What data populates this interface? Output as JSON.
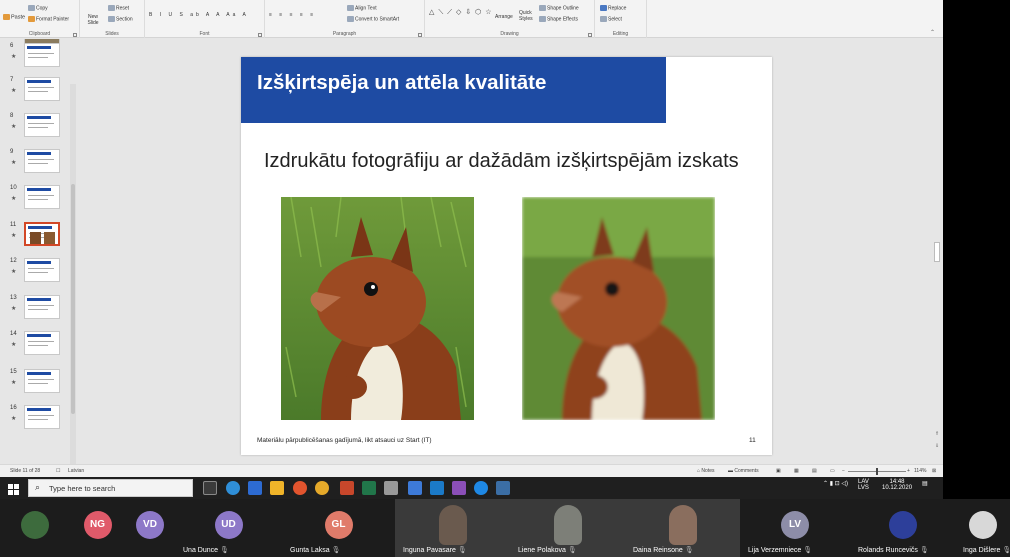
{
  "ribbon": {
    "clipboard": {
      "paste": "Paste",
      "copy": "Copy",
      "format_painter": "Format Painter",
      "label": "Clipboard"
    },
    "slides": {
      "new_slide": "New Slide",
      "reset": "Reset",
      "section": "Section",
      "label": "Slides"
    },
    "font": {
      "label": "Font"
    },
    "paragraph": {
      "align_text": "Align Text",
      "convert_smartart": "Convert to SmartArt",
      "label": "Paragraph"
    },
    "drawing": {
      "arrange": "Arrange",
      "quick_styles": "Quick Styles",
      "shape_outline": "Shape Outline",
      "shape_effects": "Shape Effects",
      "label": "Drawing"
    },
    "editing": {
      "replace": "Replace",
      "select": "Select",
      "label": "Editing"
    }
  },
  "thumbnails": [
    {
      "num": "6",
      "active": false
    },
    {
      "num": "7",
      "active": false
    },
    {
      "num": "8",
      "active": false
    },
    {
      "num": "9",
      "active": false
    },
    {
      "num": "10",
      "active": false
    },
    {
      "num": "11",
      "active": true
    },
    {
      "num": "12",
      "active": false
    },
    {
      "num": "13",
      "active": false
    },
    {
      "num": "14",
      "active": false
    },
    {
      "num": "15",
      "active": false
    },
    {
      "num": "16",
      "active": false
    }
  ],
  "slide": {
    "title": "Izšķirtspēja un attēla kvalitāte",
    "body": "Izdrukātu fotogrāfiju ar dažādām izšķirtspējām izskats",
    "footer": "Materiālu pārpublicēšanas gadījumā, likt atsauci uz Start (IT)",
    "number": "11",
    "banner_color": "#1e4ba3"
  },
  "statusbar": {
    "slide_info": "Slide 11 of 28",
    "language": "Latvian",
    "notes": "Notes",
    "comments": "Comments",
    "zoom": "114%"
  },
  "taskbar": {
    "search_placeholder": "Type here to search",
    "lang": "LAV",
    "lang2": "LVS",
    "time": "14:48",
    "date": "10.12.2020"
  },
  "participants": [
    {
      "initials": "",
      "name": "",
      "color": "#3d6b3d",
      "type": "avatar-photo"
    },
    {
      "initials": "NG",
      "name": "",
      "color": "#e05a6a",
      "type": "initials"
    },
    {
      "initials": "VD",
      "name": "",
      "color": "#8d78c8",
      "type": "initials"
    },
    {
      "initials": "UD",
      "name": "Una Dunce",
      "color": "#8d78c8",
      "type": "initials"
    },
    {
      "initials": "GL",
      "name": "Gunta Laksa",
      "color": "#e07b6a",
      "type": "initials"
    },
    {
      "initials": "",
      "name": "Inguna Pavasare",
      "color": "#6a5a4e",
      "type": "video"
    },
    {
      "initials": "",
      "name": "Liene Polakova",
      "color": "#7d7f78",
      "type": "video"
    },
    {
      "initials": "",
      "name": "Daina Reinsone",
      "color": "#8a6e5e",
      "type": "video"
    },
    {
      "initials": "LV",
      "name": "Lija Verzemniece",
      "color": "#8d8da8",
      "type": "initials"
    },
    {
      "initials": "",
      "name": "Rolands Runcevičs",
      "color": "#2d3f9a",
      "type": "avatar-photo"
    },
    {
      "initials": "",
      "name": "Inga Dišlere",
      "color": "#d8d8d8",
      "type": "initials"
    }
  ]
}
